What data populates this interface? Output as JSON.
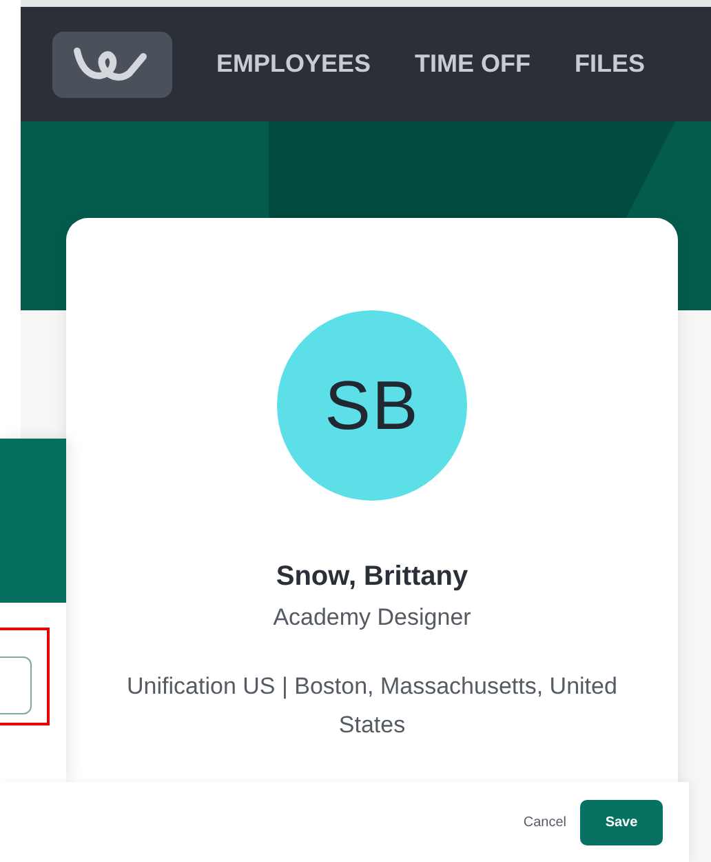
{
  "nav": {
    "items": [
      {
        "label": "EMPLOYEES"
      },
      {
        "label": "TIME OFF"
      },
      {
        "label": "FILES"
      }
    ]
  },
  "profile": {
    "initials": "SB",
    "name": "Snow, Brittany",
    "job_title": "Academy Designer",
    "location": "Unification US | Boston, Massachusetts, United States"
  },
  "footer": {
    "buttons": [
      {
        "label": "Cancel",
        "kind": "secondary"
      },
      {
        "label": "Save",
        "kind": "primary"
      }
    ]
  }
}
